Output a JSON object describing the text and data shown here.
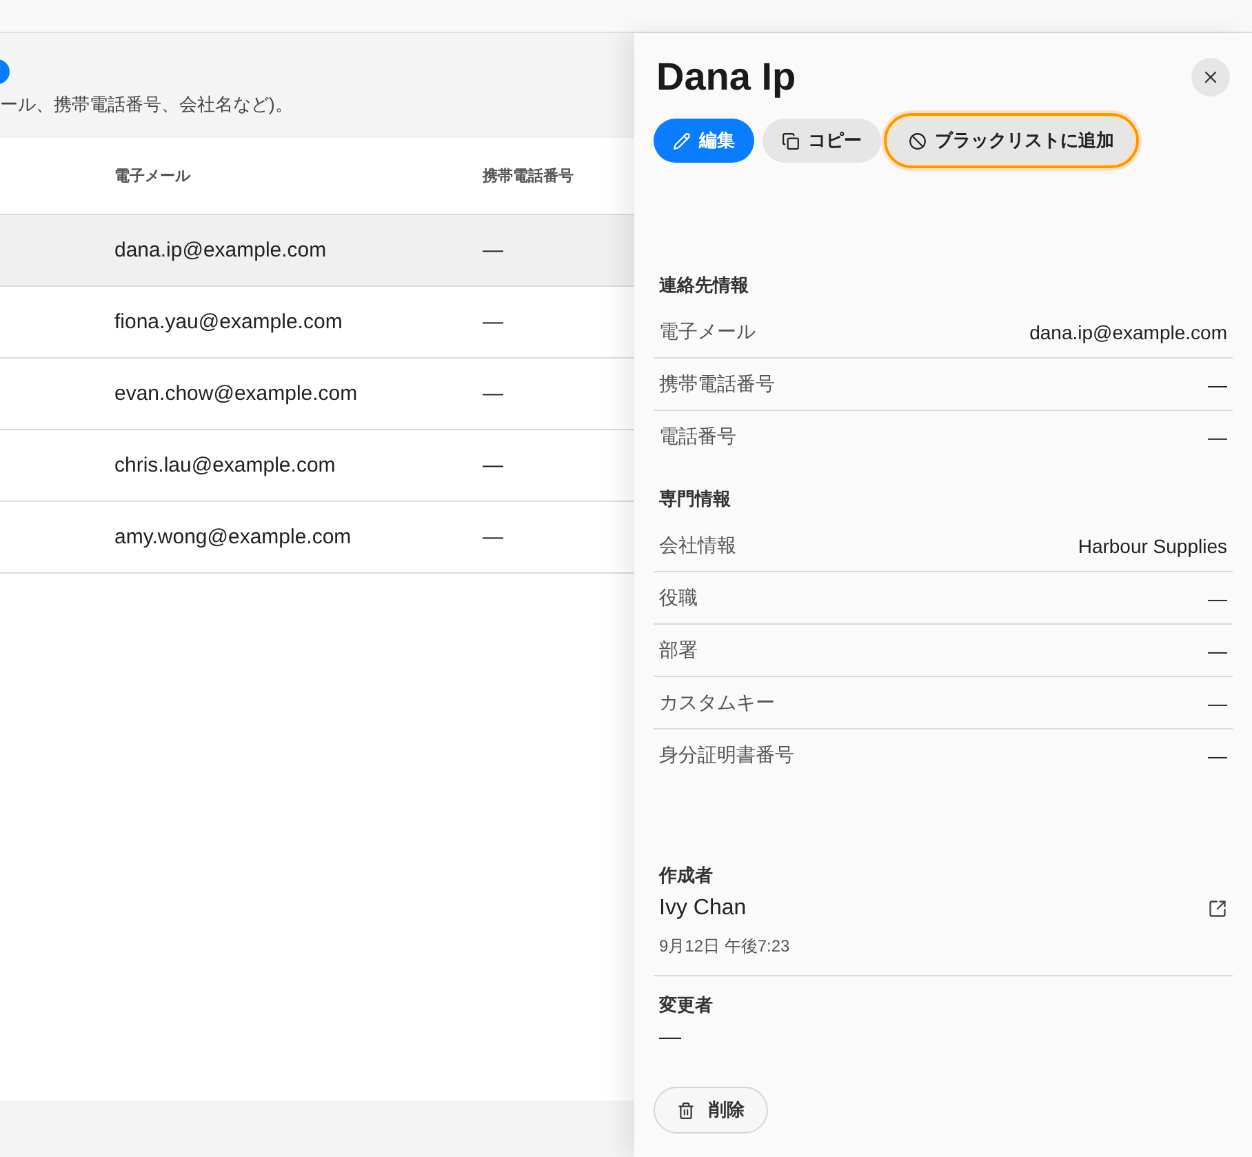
{
  "page": {
    "description": "ール、携帯電話番号、会社名など)。",
    "table": {
      "columns": [
        "電子メール",
        "携帯電話番号"
      ],
      "rows": [
        {
          "email": "dana.ip@example.com",
          "mobile": "—",
          "selected": true
        },
        {
          "email": "fiona.yau@example.com",
          "mobile": "—",
          "selected": false
        },
        {
          "email": "evan.chow@example.com",
          "mobile": "—",
          "selected": false
        },
        {
          "email": "chris.lau@example.com",
          "mobile": "—",
          "selected": false
        },
        {
          "email": "amy.wong@example.com",
          "mobile": "—",
          "selected": false
        }
      ]
    }
  },
  "drawer": {
    "title": "Dana Ip",
    "actions": [
      {
        "kind": "edit",
        "label": "編集",
        "focused": false
      },
      {
        "kind": "copy",
        "label": "コピー",
        "focused": false
      },
      {
        "kind": "blacklist",
        "label": "ブラックリストに追加",
        "focused": true
      }
    ],
    "sections": [
      {
        "title": "連絡先情報",
        "fields": [
          {
            "label": "電子メール",
            "value": "dana.ip@example.com"
          },
          {
            "label": "携帯電話番号",
            "value": "—"
          },
          {
            "label": "電話番号",
            "value": "—"
          }
        ]
      },
      {
        "title": "専門情報",
        "fields": [
          {
            "label": "会社情報",
            "value": "Harbour Supplies"
          },
          {
            "label": "役職",
            "value": "—"
          },
          {
            "label": "部署",
            "value": "—"
          },
          {
            "label": "カスタムキー",
            "value": "—"
          },
          {
            "label": "身分証明書番号",
            "value": "—"
          }
        ]
      }
    ],
    "created_by": {
      "title": "作成者",
      "name": "Ivy Chan",
      "date": "9月12日 午後7:23"
    },
    "modified_by": {
      "title": "変更者",
      "value": "—"
    },
    "delete_label": "削除"
  }
}
